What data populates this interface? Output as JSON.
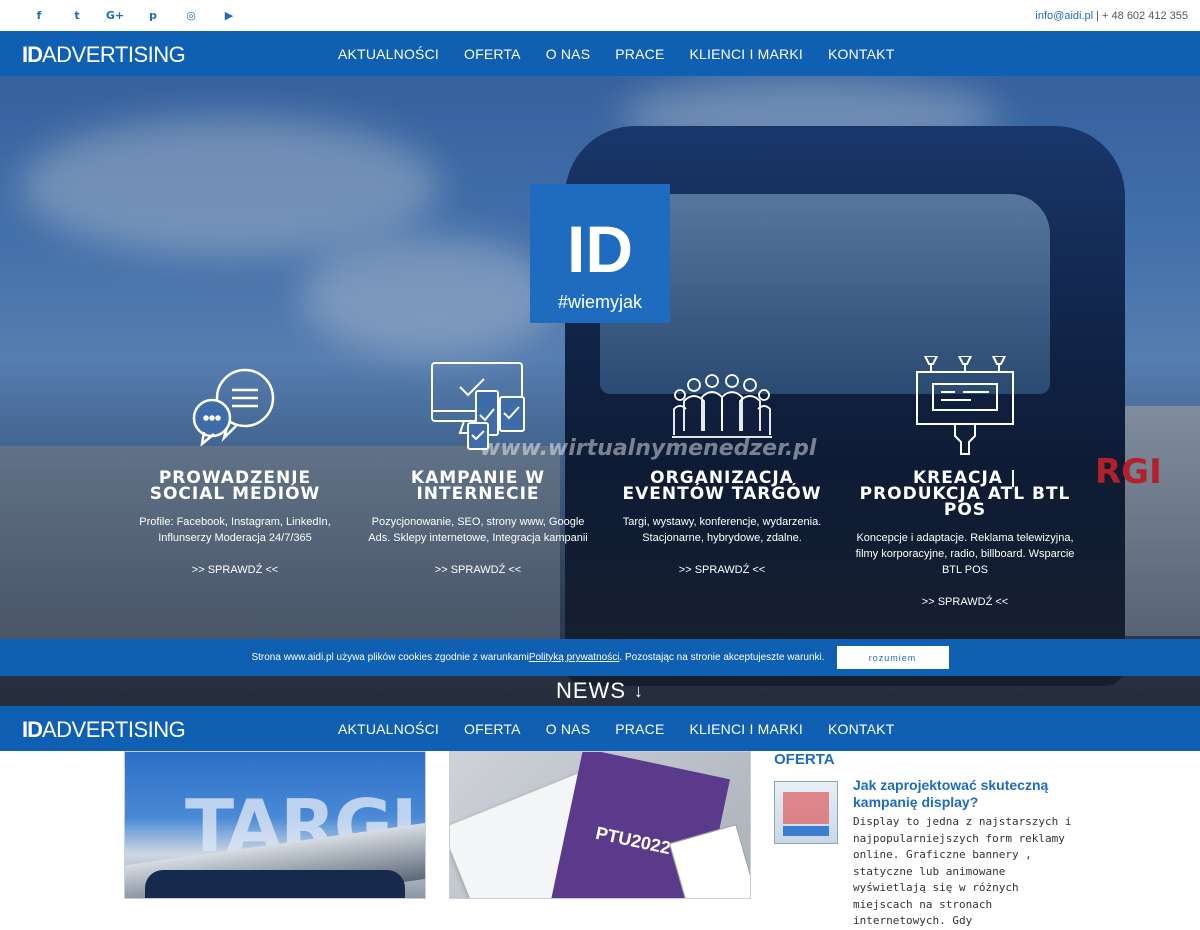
{
  "topbar": {
    "social": [
      {
        "icon": "facebook-icon",
        "glyph": "f"
      },
      {
        "icon": "twitter-icon",
        "glyph": "t"
      },
      {
        "icon": "google-plus-icon",
        "glyph": "G+"
      },
      {
        "icon": "pinterest-icon",
        "glyph": "p"
      },
      {
        "icon": "instagram-icon",
        "glyph": "◎"
      },
      {
        "icon": "youtube-icon",
        "glyph": "▶"
      }
    ],
    "email": "info@aidi.pl",
    "phone": " | + 48 602 412 355"
  },
  "brand": {
    "logo_bold": "ID",
    "logo_rest": "ADVERTISING"
  },
  "menu": [
    "AKTUALNOŚCI",
    "OFERTA",
    "O NAS",
    "PRACE",
    "KLIENCI I MARKI",
    "KONTAKT"
  ],
  "hero": {
    "badge_big": "ID",
    "badge_tag": "#wiemyjak",
    "watermark": "www.wirtualnymenedzer.pl",
    "accent": "#1e6bbf"
  },
  "services": [
    {
      "icon": "chat-bubbles-icon",
      "title": "PROWADZENIE SOCIAL MEDIÓW",
      "desc": "Profile: Facebook, Instagram, LinkedIn, Influnserzy Moderacja 24/7/365",
      "more": ">> SPRAWDŹ <<"
    },
    {
      "icon": "devices-icon",
      "title": "KAMPANIE W INTERNECIE",
      "desc": "Pozycjonowanie, SEO, strony www, Google Ads. Sklepy internetowe, Integracja kampanii",
      "more": ">> SPRAWDŹ <<"
    },
    {
      "icon": "people-group-icon",
      "title": "ORGANIZACJA EVENTÓW TARGÓW",
      "desc": "Targi, wystawy, konferencje, wydarzenia. Stacjonarne, hybrydowe, zdalne.",
      "more": ">> SPRAWDŹ <<"
    },
    {
      "icon": "billboard-icon",
      "title": "KREACJA | PRODUKCJA ATL BTL POS",
      "desc": "Koncepcje i adaptacje. Reklama telewizyjna, filmy korporacyjne, radio, billboard. Wsparcie BTL POS",
      "more": ">> SPRAWDŹ <<"
    }
  ],
  "cookie": {
    "text_before": "Strona www.aidi.pl używa plików cookies zgodnie z warunkami ",
    "link": "Polityką prywatności",
    "text_after": ". Pozostając na stronie akceptujeszte warunki.",
    "button": "rozumiem"
  },
  "news": {
    "label": "NEWS",
    "arrow": "↓"
  },
  "cards": [
    {
      "image_text": "TARGI"
    },
    {
      "image_text": "PTU2022"
    }
  ],
  "sidebar": {
    "heading": "OFERTA",
    "article_title": "Jak zaprojektować skuteczną kampanię display?",
    "article_body": "Display to jedna z najstarszych i najpopularniejszych form reklamy online. Graficzne bannery , statyczne lub animowane wyświetlają się w różnych miejscach na stronach internetowych. Gdy"
  }
}
